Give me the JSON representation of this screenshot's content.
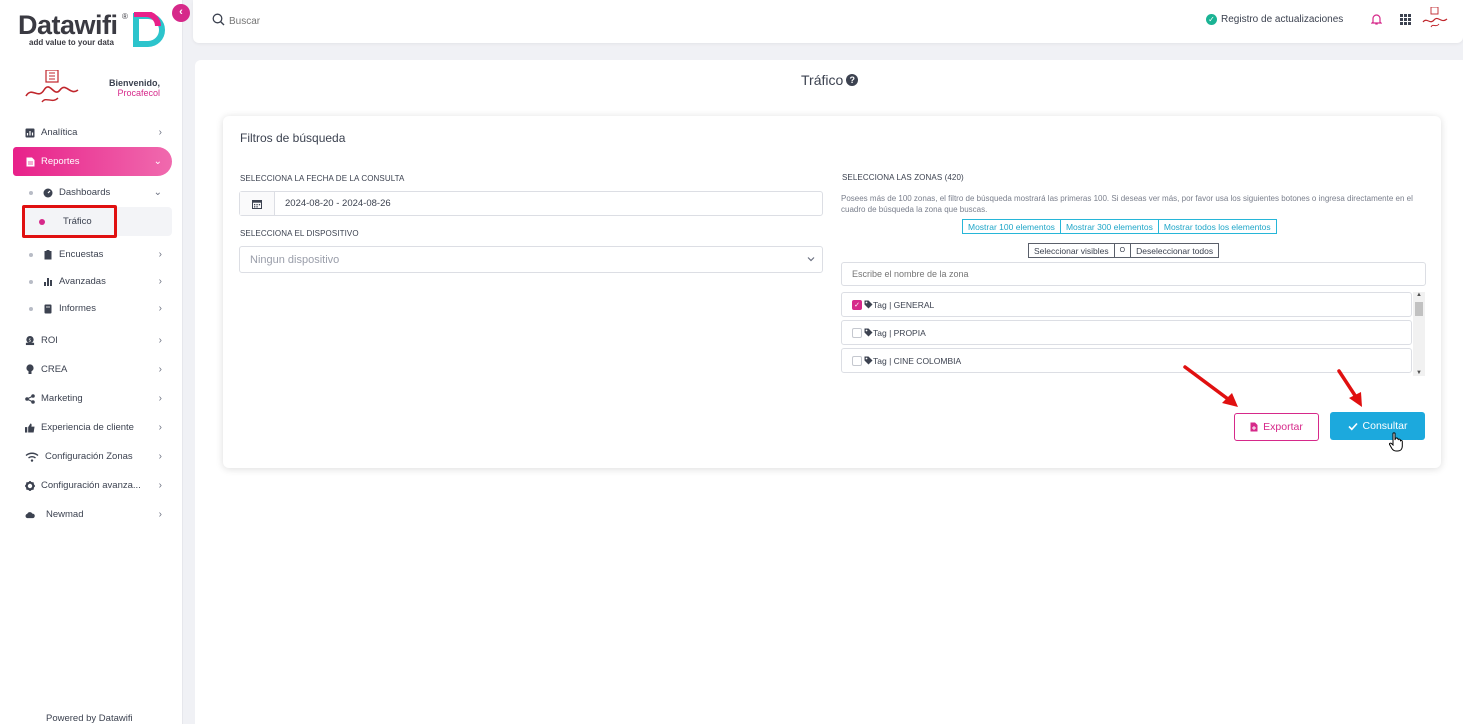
{
  "brand": {
    "name": "Datawifi",
    "registered": "®",
    "tagline": "add value to your data",
    "accent": "#d6298a",
    "primary": "#1ca9dd"
  },
  "sidebar": {
    "welcome": "Bienvenido,",
    "user": "Procafecol",
    "items": [
      {
        "label": "Analítica",
        "icon": "chart-box-icon"
      },
      {
        "label": "Reportes",
        "icon": "document-icon",
        "active": true
      },
      {
        "label": "Dashboards",
        "icon": "gauge-icon"
      },
      {
        "label": "Tráfico",
        "selected": true
      },
      {
        "label": "Encuestas",
        "icon": "clipboard-icon"
      },
      {
        "label": "Avanzadas",
        "icon": "bar-chart-icon"
      },
      {
        "label": "Informes",
        "icon": "book-icon"
      },
      {
        "label": "ROI",
        "icon": "money-icon"
      },
      {
        "label": "CREA",
        "icon": "bulb-icon"
      },
      {
        "label": "Marketing",
        "icon": "share-icon"
      },
      {
        "label": "Experiencia de cliente",
        "icon": "thumbs-up-icon"
      },
      {
        "label": "Configuración Zonas",
        "icon": "wifi-icon"
      },
      {
        "label": "Configuración avanza...",
        "icon": "gear-icon"
      },
      {
        "label": "Newmad",
        "icon": "cloud-icon"
      }
    ],
    "powered": "Powered by Datawifi"
  },
  "topbar": {
    "search_placeholder": "Buscar",
    "updates": "Registro de actualizaciones"
  },
  "page": {
    "title": "Tráfico",
    "help": "?"
  },
  "filters": {
    "title": "Filtros de búsqueda",
    "date_label": "SELECCIONA LA FECHA DE LA CONSULTA",
    "date_value": "2024-08-20 - 2024-08-26",
    "device_label": "SELECCIONA EL DISPOSITIVO",
    "device_value": "Ningun dispositivo",
    "zones_label": "SELECCIONA LAS ZONAS (420)",
    "zones_note": "Posees más de 100 zonas, el filtro de búsqueda mostrará las primeras 100. Si deseas ver más, por favor usa los siguientes botones o ingresa directamente en el cuadro de búsqueda la zona que buscas.",
    "show_buttons": [
      "Mostrar 100 elementos",
      "Mostrar 300 elementos",
      "Mostrar todos los elementos"
    ],
    "select_visible": "Seleccionar visibles",
    "select_separator": "O",
    "deselect_all": "Deseleccionar todos",
    "zone_search_placeholder": "Escribe el nombre de la zona",
    "zones": [
      {
        "label": "Tag | GENERAL",
        "checked": true
      },
      {
        "label": "Tag | PROPIA",
        "checked": false
      },
      {
        "label": "Tag | CINE COLOMBIA",
        "checked": false
      }
    ],
    "export_label": "Exportar",
    "consult_label": "Consultar"
  }
}
